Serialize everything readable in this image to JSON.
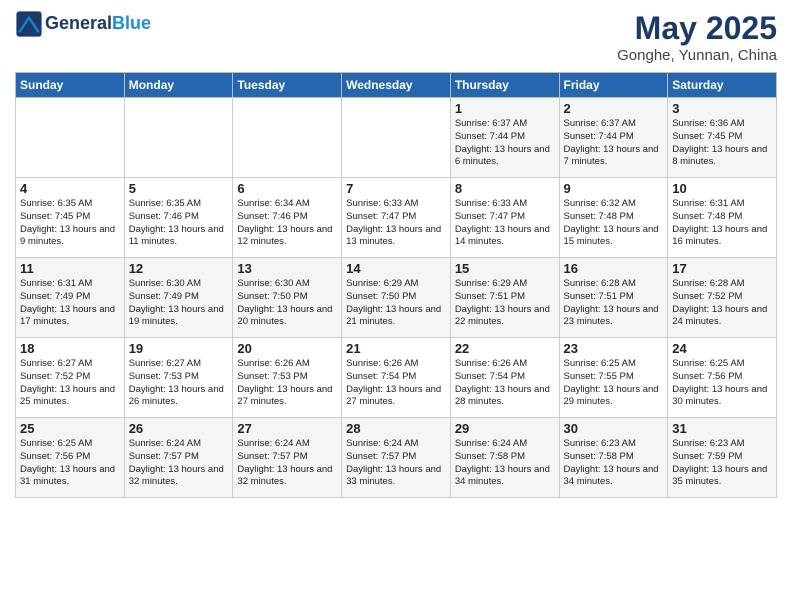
{
  "header": {
    "logo_line1": "General",
    "logo_line2": "Blue",
    "month_title": "May 2025",
    "location": "Gonghe, Yunnan, China"
  },
  "days_of_week": [
    "Sunday",
    "Monday",
    "Tuesday",
    "Wednesday",
    "Thursday",
    "Friday",
    "Saturday"
  ],
  "weeks": [
    [
      {
        "day": "",
        "text": ""
      },
      {
        "day": "",
        "text": ""
      },
      {
        "day": "",
        "text": ""
      },
      {
        "day": "",
        "text": ""
      },
      {
        "day": "1",
        "text": "Sunrise: 6:37 AM\nSunset: 7:44 PM\nDaylight: 13 hours and 6 minutes."
      },
      {
        "day": "2",
        "text": "Sunrise: 6:37 AM\nSunset: 7:44 PM\nDaylight: 13 hours and 7 minutes."
      },
      {
        "day": "3",
        "text": "Sunrise: 6:36 AM\nSunset: 7:45 PM\nDaylight: 13 hours and 8 minutes."
      }
    ],
    [
      {
        "day": "4",
        "text": "Sunrise: 6:35 AM\nSunset: 7:45 PM\nDaylight: 13 hours and 9 minutes."
      },
      {
        "day": "5",
        "text": "Sunrise: 6:35 AM\nSunset: 7:46 PM\nDaylight: 13 hours and 11 minutes."
      },
      {
        "day": "6",
        "text": "Sunrise: 6:34 AM\nSunset: 7:46 PM\nDaylight: 13 hours and 12 minutes."
      },
      {
        "day": "7",
        "text": "Sunrise: 6:33 AM\nSunset: 7:47 PM\nDaylight: 13 hours and 13 minutes."
      },
      {
        "day": "8",
        "text": "Sunrise: 6:33 AM\nSunset: 7:47 PM\nDaylight: 13 hours and 14 minutes."
      },
      {
        "day": "9",
        "text": "Sunrise: 6:32 AM\nSunset: 7:48 PM\nDaylight: 13 hours and 15 minutes."
      },
      {
        "day": "10",
        "text": "Sunrise: 6:31 AM\nSunset: 7:48 PM\nDaylight: 13 hours and 16 minutes."
      }
    ],
    [
      {
        "day": "11",
        "text": "Sunrise: 6:31 AM\nSunset: 7:49 PM\nDaylight: 13 hours and 17 minutes."
      },
      {
        "day": "12",
        "text": "Sunrise: 6:30 AM\nSunset: 7:49 PM\nDaylight: 13 hours and 19 minutes."
      },
      {
        "day": "13",
        "text": "Sunrise: 6:30 AM\nSunset: 7:50 PM\nDaylight: 13 hours and 20 minutes."
      },
      {
        "day": "14",
        "text": "Sunrise: 6:29 AM\nSunset: 7:50 PM\nDaylight: 13 hours and 21 minutes."
      },
      {
        "day": "15",
        "text": "Sunrise: 6:29 AM\nSunset: 7:51 PM\nDaylight: 13 hours and 22 minutes."
      },
      {
        "day": "16",
        "text": "Sunrise: 6:28 AM\nSunset: 7:51 PM\nDaylight: 13 hours and 23 minutes."
      },
      {
        "day": "17",
        "text": "Sunrise: 6:28 AM\nSunset: 7:52 PM\nDaylight: 13 hours and 24 minutes."
      }
    ],
    [
      {
        "day": "18",
        "text": "Sunrise: 6:27 AM\nSunset: 7:52 PM\nDaylight: 13 hours and 25 minutes."
      },
      {
        "day": "19",
        "text": "Sunrise: 6:27 AM\nSunset: 7:53 PM\nDaylight: 13 hours and 26 minutes."
      },
      {
        "day": "20",
        "text": "Sunrise: 6:26 AM\nSunset: 7:53 PM\nDaylight: 13 hours and 27 minutes."
      },
      {
        "day": "21",
        "text": "Sunrise: 6:26 AM\nSunset: 7:54 PM\nDaylight: 13 hours and 27 minutes."
      },
      {
        "day": "22",
        "text": "Sunrise: 6:26 AM\nSunset: 7:54 PM\nDaylight: 13 hours and 28 minutes."
      },
      {
        "day": "23",
        "text": "Sunrise: 6:25 AM\nSunset: 7:55 PM\nDaylight: 13 hours and 29 minutes."
      },
      {
        "day": "24",
        "text": "Sunrise: 6:25 AM\nSunset: 7:56 PM\nDaylight: 13 hours and 30 minutes."
      }
    ],
    [
      {
        "day": "25",
        "text": "Sunrise: 6:25 AM\nSunset: 7:56 PM\nDaylight: 13 hours and 31 minutes."
      },
      {
        "day": "26",
        "text": "Sunrise: 6:24 AM\nSunset: 7:57 PM\nDaylight: 13 hours and 32 minutes."
      },
      {
        "day": "27",
        "text": "Sunrise: 6:24 AM\nSunset: 7:57 PM\nDaylight: 13 hours and 32 minutes."
      },
      {
        "day": "28",
        "text": "Sunrise: 6:24 AM\nSunset: 7:57 PM\nDaylight: 13 hours and 33 minutes."
      },
      {
        "day": "29",
        "text": "Sunrise: 6:24 AM\nSunset: 7:58 PM\nDaylight: 13 hours and 34 minutes."
      },
      {
        "day": "30",
        "text": "Sunrise: 6:23 AM\nSunset: 7:58 PM\nDaylight: 13 hours and 34 minutes."
      },
      {
        "day": "31",
        "text": "Sunrise: 6:23 AM\nSunset: 7:59 PM\nDaylight: 13 hours and 35 minutes."
      }
    ]
  ]
}
